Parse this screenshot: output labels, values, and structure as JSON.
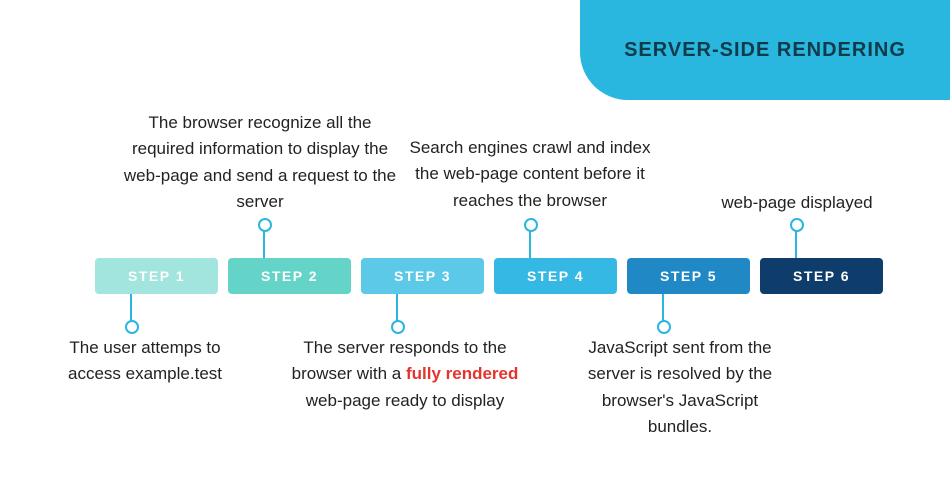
{
  "header": {
    "title": "SERVER-SIDE RENDERING"
  },
  "steps": [
    {
      "label": "STEP 1",
      "color": "#a2e4de",
      "desc_pos": "bottom",
      "desc": "The user attemps to access example.test"
    },
    {
      "label": "STEP 2",
      "color": "#63d4c7",
      "desc_pos": "top",
      "desc": "The browser recognize all the required information to display the web-page and send a request to the server"
    },
    {
      "label": "STEP 3",
      "color": "#5cc9e8",
      "desc_pos": "bottom",
      "desc_parts": [
        "The server responds to the browser with a ",
        "fully rendered",
        " web-page ready to display"
      ]
    },
    {
      "label": "STEP 4",
      "color": "#35b8e4",
      "desc_pos": "top",
      "desc": "Search engines crawl and index the web-page content before it reaches the browser"
    },
    {
      "label": "STEP 5",
      "color": "#1f88c5",
      "desc_pos": "bottom",
      "desc": "JavaScript sent from the server is resolved by the browser's JavaScript bundles."
    },
    {
      "label": "STEP 6",
      "color": "#0e3d6b",
      "desc_pos": "top",
      "desc": "web-page displayed"
    }
  ]
}
